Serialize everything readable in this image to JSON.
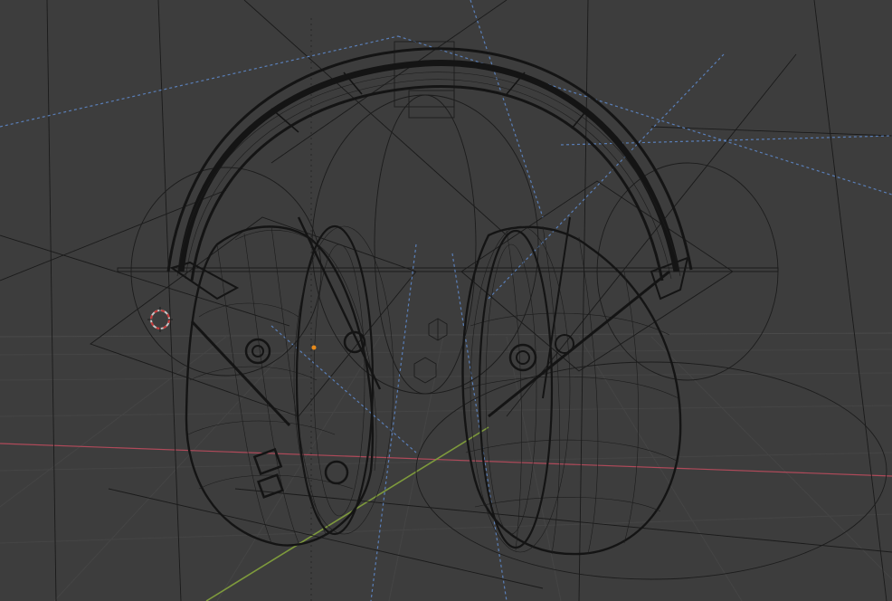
{
  "viewport": {
    "mode": "wireframe",
    "background_color": "#3d3d3d",
    "object_name": "headphones",
    "colors": {
      "x_axis": "#b04a5a",
      "y_axis": "#7e9a3c",
      "wire": "#141414",
      "light_dashes": "#5a7fb8",
      "origin_dot": "#e88a1a",
      "cursor_ring": "#c8c8c8",
      "cursor_red": "#c83a3a"
    }
  }
}
